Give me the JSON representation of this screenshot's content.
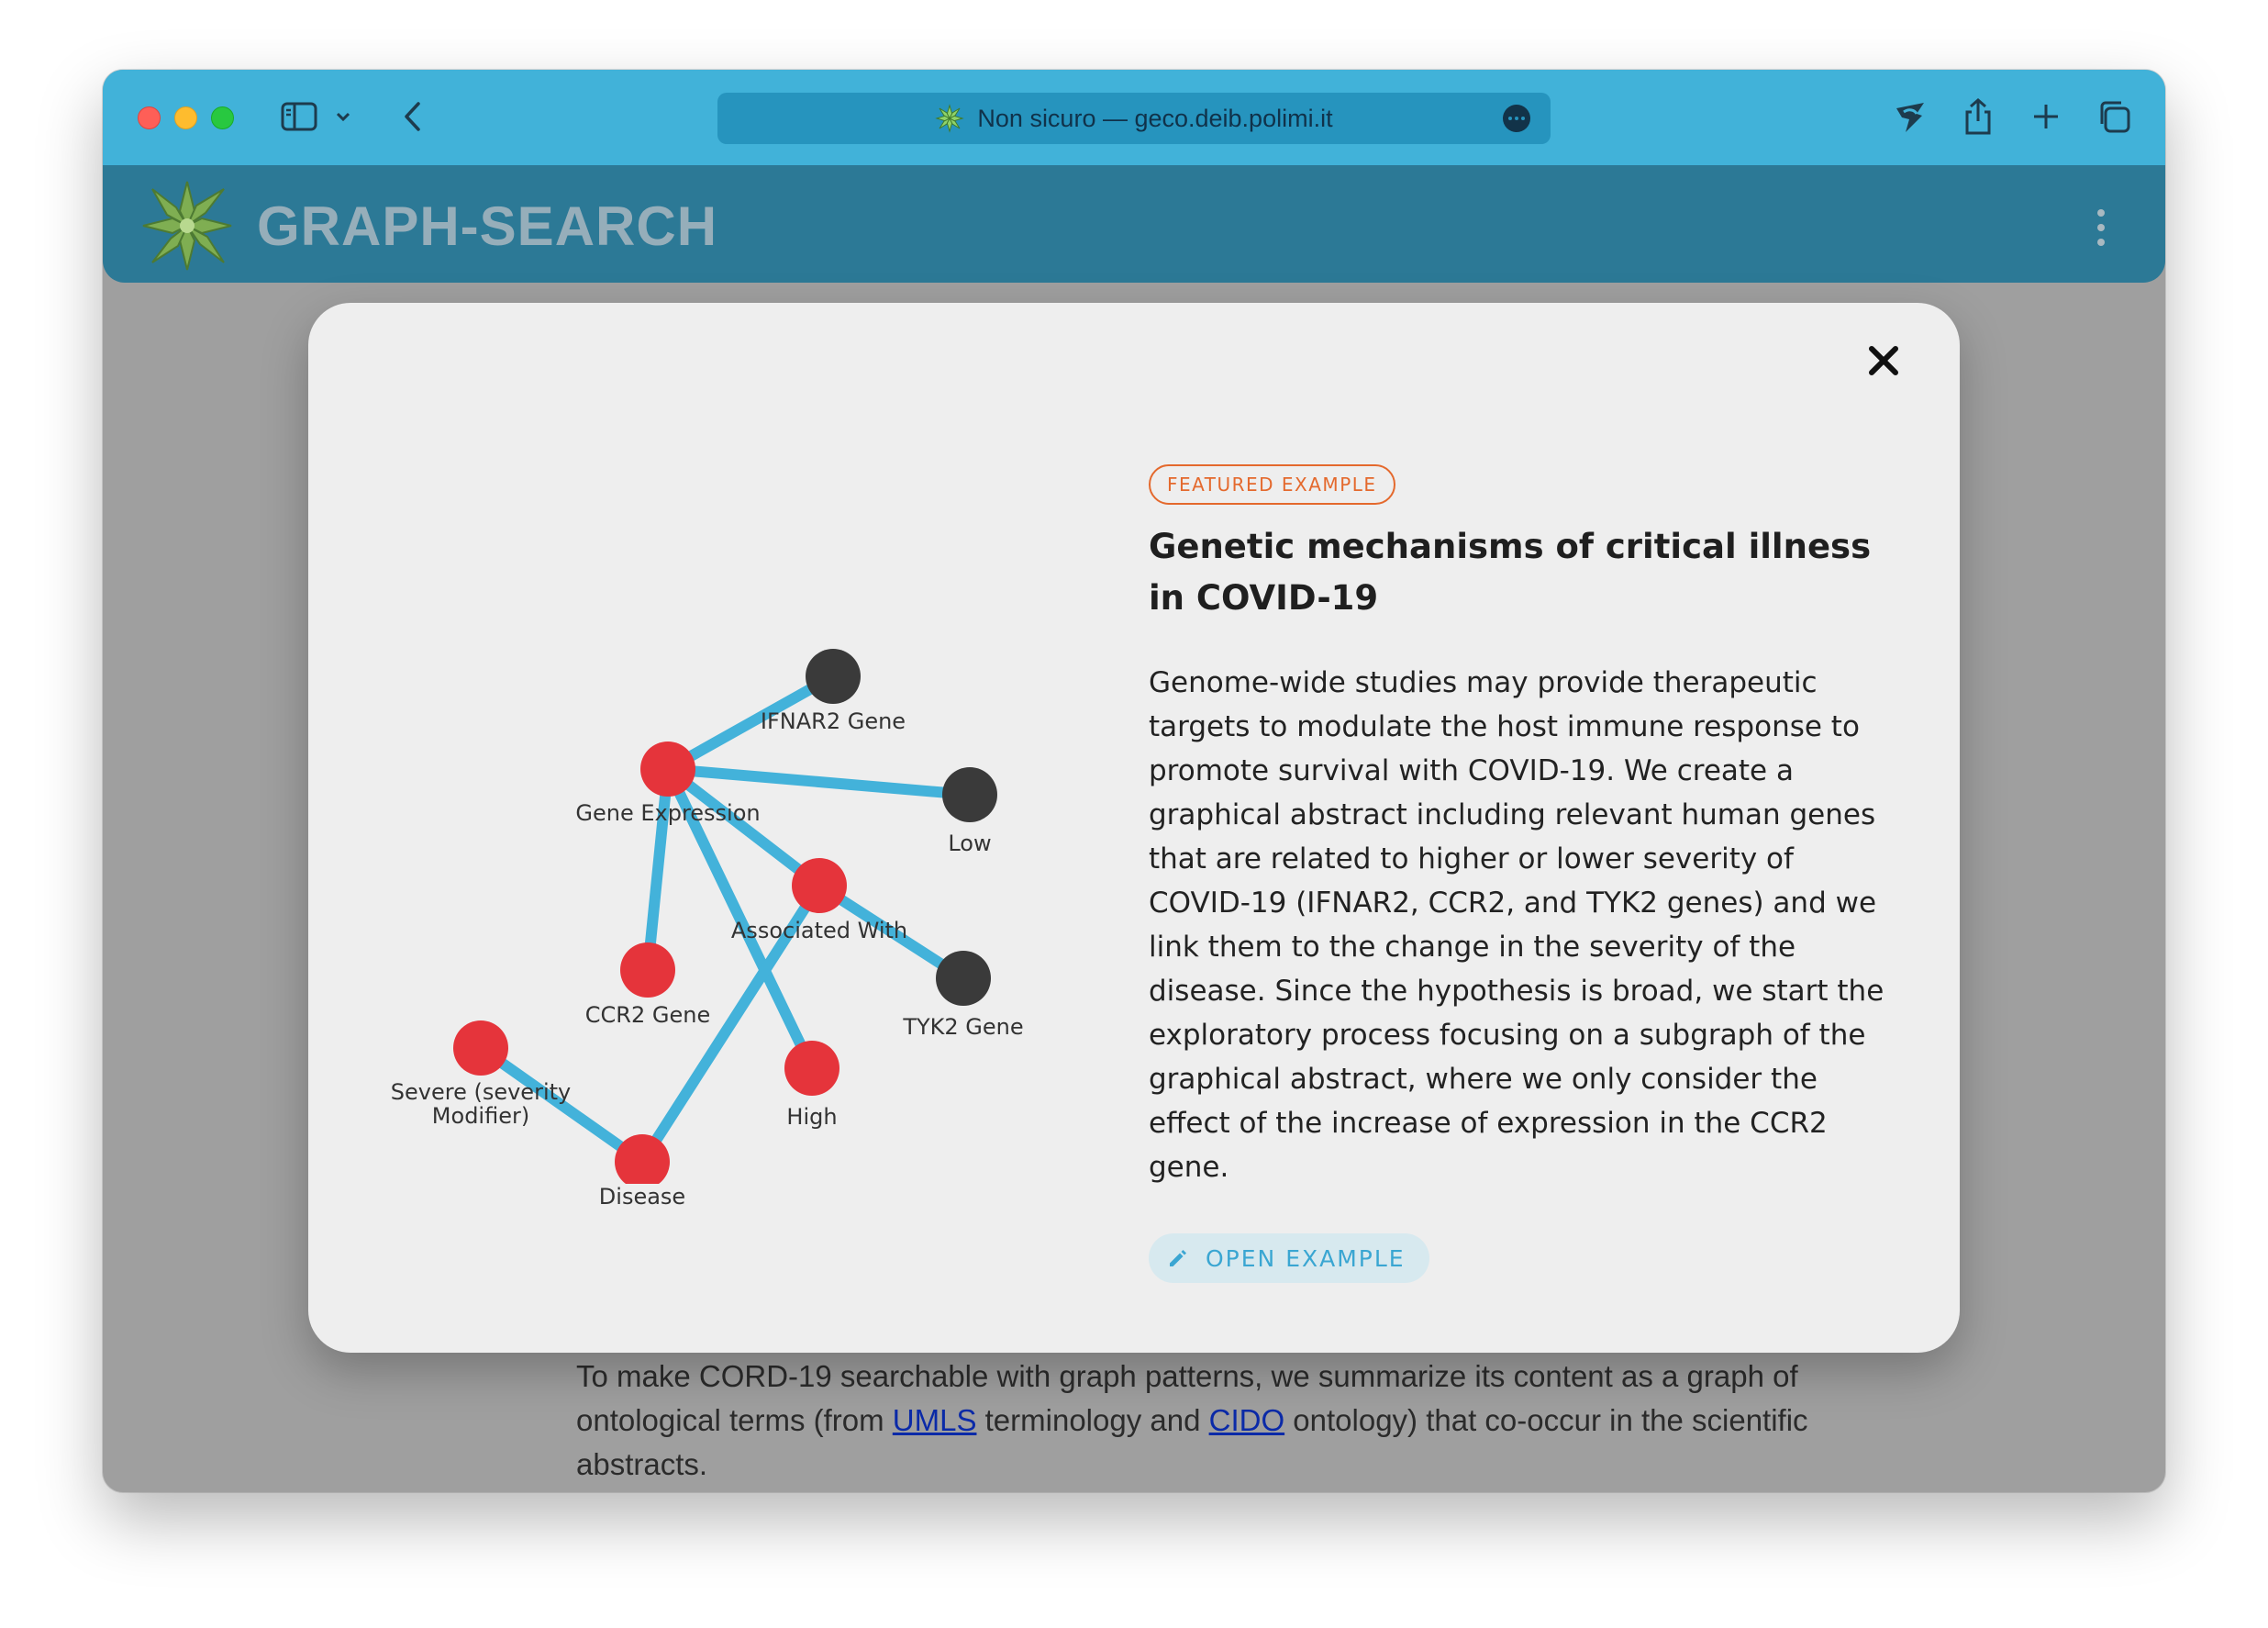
{
  "browser": {
    "url_text": "Non sicuro — geco.deib.polimi.it"
  },
  "app": {
    "title": "GRAPH-SEARCH"
  },
  "modal": {
    "badge": "FEATURED EXAMPLE",
    "title": "Genetic mechanisms of critical illness in COVID-19",
    "description": "Genome-wide studies may provide therapeutic targets to modulate the host immune response to promote survival with COVID-19. We create a graphical abstract including relevant human genes that are related to higher or lower severity of COVID-19 (IFNAR2, CCR2, and TYK2 genes) and we link them to the change in the severity of the disease. Since the hypothesis is broad, we start the exploratory process focusing on a subgraph of the graphical abstract, where we only consider the effect of the increase of expression in the CCR2 gene.",
    "open_button": "OPEN EXAMPLE",
    "graph": {
      "nodes": {
        "ifnar2": "IFNAR2 Gene",
        "gene_expression": "Gene Expression",
        "low": "Low",
        "associated_with": "Associated With",
        "ccr2": "CCR2 Gene",
        "tyk2": "TYK2 Gene",
        "severe_line1": "Severe (severity",
        "severe_line2": "Modifier)",
        "high": "High",
        "disease": "Disease"
      }
    }
  },
  "background": {
    "text_before_umls": "To make CORD-19 searchable with graph patterns, we summarize its content as a graph of ontological terms (from ",
    "umls": "UMLS",
    "text_mid": " terminology and ",
    "cido": "CIDO",
    "text_after": " ontology) that co-occur in the scientific abstracts."
  },
  "colors": {
    "titlebar": "#41b2d9",
    "header": "#2c7996",
    "edge": "#43b2da",
    "node_red": "#e5343b",
    "node_dark": "#3a3a3a",
    "badge": "#e4692d",
    "button_text": "#3aa6d2"
  }
}
